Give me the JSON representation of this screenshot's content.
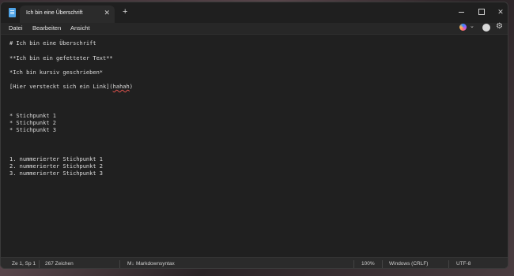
{
  "window": {
    "tab_title": "Ich bin eine Überschrift",
    "tab_close": "✕",
    "new_tab": "+",
    "minimize": "",
    "maximize": "",
    "close": "✕"
  },
  "menu": {
    "items": [
      "Datei",
      "Bearbeiten",
      "Ansicht"
    ],
    "chevron": "⌄",
    "settings_glyph": "⚙"
  },
  "editor": {
    "lines": [
      "# Ich bin eine Überschrift",
      "**Ich bin ein gefetteter Text**",
      "*Ich bin kursiv geschrieben*",
      "[Hier versteckt sich ein Link](",
      "* Stichpunkt 1",
      "* Stichpunkt 2",
      "* Stichpunkt 3",
      "1. nummerierter Stichpunkt 1",
      "2. nummerierter Stichpunkt 2",
      "3. nummerierter Stichpunkt 3"
    ],
    "link_target": "hahah",
    "link_close": ")"
  },
  "status": {
    "position": "Ze 1, Sp 1",
    "char_count": "267 Zeichen",
    "markdown_icon": "M↓",
    "markdown": "Markdownsyntax",
    "zoom": "100%",
    "line_ending": "Windows (CRLF)",
    "encoding": "UTF-8"
  }
}
